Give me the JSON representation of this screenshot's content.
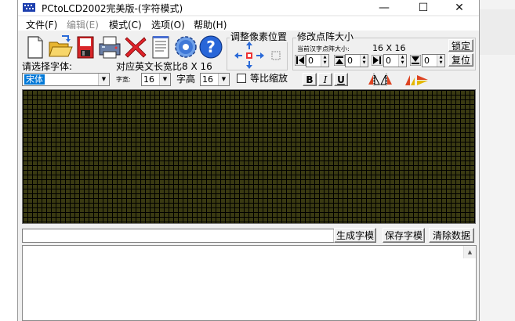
{
  "window": {
    "title": "PCtoLCD2002完美版-(字符模式)",
    "minimize": "—",
    "maximize": "☐",
    "close": "✕"
  },
  "menu": [
    {
      "label": "文件(F)",
      "enabled": true
    },
    {
      "label": "编辑(E)",
      "enabled": false
    },
    {
      "label": "模式(C)",
      "enabled": true
    },
    {
      "label": "选项(O)",
      "enabled": true
    },
    {
      "label": "帮助(H)",
      "enabled": true
    }
  ],
  "toolbar": {
    "icons": [
      "new-file-icon",
      "open-folder-icon",
      "save-disk-icon",
      "print-icon",
      "delete-x-icon",
      "notepad-icon",
      "settings-gear-icon",
      "help-icon"
    ]
  },
  "font": {
    "label": "请选择字体:",
    "value": "宋体",
    "width_label": "字宽:",
    "width_value": "16",
    "height_label": "字高",
    "height_value": "16",
    "ratio_label": "对应英文长宽比8 X 16",
    "scale_label": "等比缩放",
    "scale_checked": false,
    "bold": "B",
    "italic": "I",
    "underline": "U"
  },
  "pixel_adjust": {
    "title": "调整像素位置"
  },
  "dot_matrix": {
    "title": "修改点阵大小",
    "current_label": "当前汉字点阵大小:",
    "current_size": "16 X 16",
    "lock_button": "锁定",
    "restore_button": "复位",
    "spin_values": [
      "0",
      "0",
      "0",
      "0"
    ]
  },
  "bottom": {
    "combo_value": "",
    "generate_button": "生成字模",
    "save_button": "保存字模",
    "clear_button": "清除数据"
  },
  "colors": {
    "grid_bg": "#3a3a12",
    "grid_line": "#000000",
    "highlight": "#0078d7"
  }
}
